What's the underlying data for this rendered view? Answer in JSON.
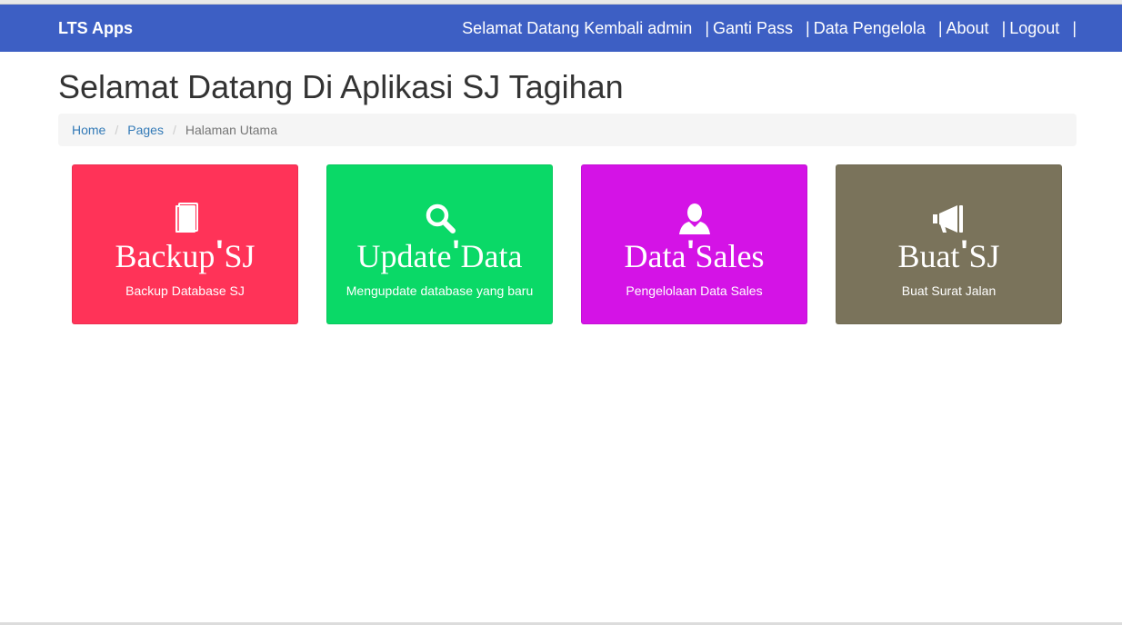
{
  "navbar": {
    "brand": "LTS Apps",
    "welcome": "Selamat Datang Kembali admin",
    "sep": "|",
    "links": [
      "Ganti Pass",
      "Data Pengelola",
      "About",
      "Logout"
    ],
    "bg_color": "#3d5fc4"
  },
  "page": {
    "title": "Selamat Datang Di Aplikasi SJ Tagihan"
  },
  "breadcrumb": {
    "items": [
      "Home",
      "Pages"
    ],
    "active": "Halaman Utama",
    "divider": "/"
  },
  "cards": [
    {
      "icon": "book-icon",
      "title_a": "Backup",
      "title_b": "SJ",
      "desc": "Backup Database SJ",
      "color": "#ff3358"
    },
    {
      "icon": "search-icon",
      "title_a": "Update",
      "title_b": "Data",
      "desc": "Mengupdate database yang baru",
      "color": "#0ad967"
    },
    {
      "icon": "user-icon",
      "title_a": "Data",
      "title_b": "Sales",
      "desc": "Pengelolaan Data Sales",
      "color": "#d413e6"
    },
    {
      "icon": "bullhorn-icon",
      "title_a": "Buat",
      "title_b": "SJ",
      "desc": "Buat Surat Jalan",
      "color": "#7a735b"
    }
  ]
}
